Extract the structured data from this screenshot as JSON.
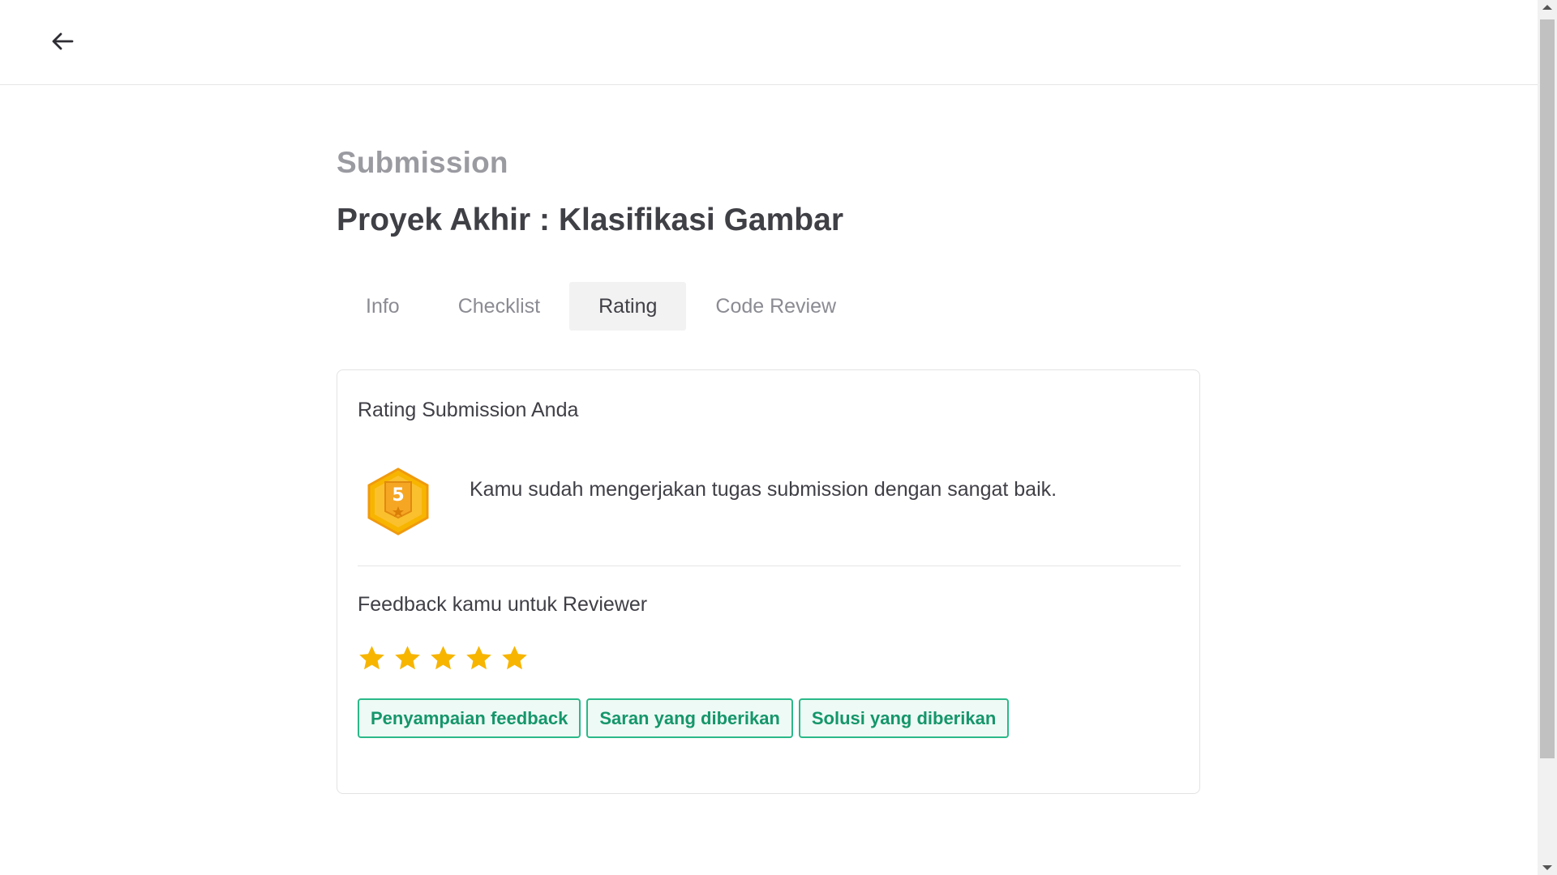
{
  "header": {
    "back_icon": "arrow-left-icon"
  },
  "page": {
    "eyebrow": "Submission",
    "title": "Proyek Akhir : Klasifikasi Gambar"
  },
  "tabs": [
    {
      "label": "Info",
      "active": false
    },
    {
      "label": "Checklist",
      "active": false
    },
    {
      "label": "Rating",
      "active": true
    },
    {
      "label": "Code Review",
      "active": false
    }
  ],
  "rating_card": {
    "heading": "Rating Submission Anda",
    "badge_value": "5",
    "badge_icon": "hexagon-badge-icon",
    "description": "Kamu sudah mengerjakan tugas submission dengan sangat baik."
  },
  "feedback": {
    "heading": "Feedback kamu untuk Reviewer",
    "stars_filled": 5,
    "stars_total": 5,
    "star_color": "#f7b500",
    "chips": [
      "Penyampaian feedback",
      "Saran yang diberikan",
      "Solusi yang diberikan"
    ]
  },
  "colors": {
    "accent_green": "#15966b",
    "badge_orange": "#f0a21a",
    "text_dark": "#3f3f46",
    "text_muted": "#9a9aa1"
  }
}
